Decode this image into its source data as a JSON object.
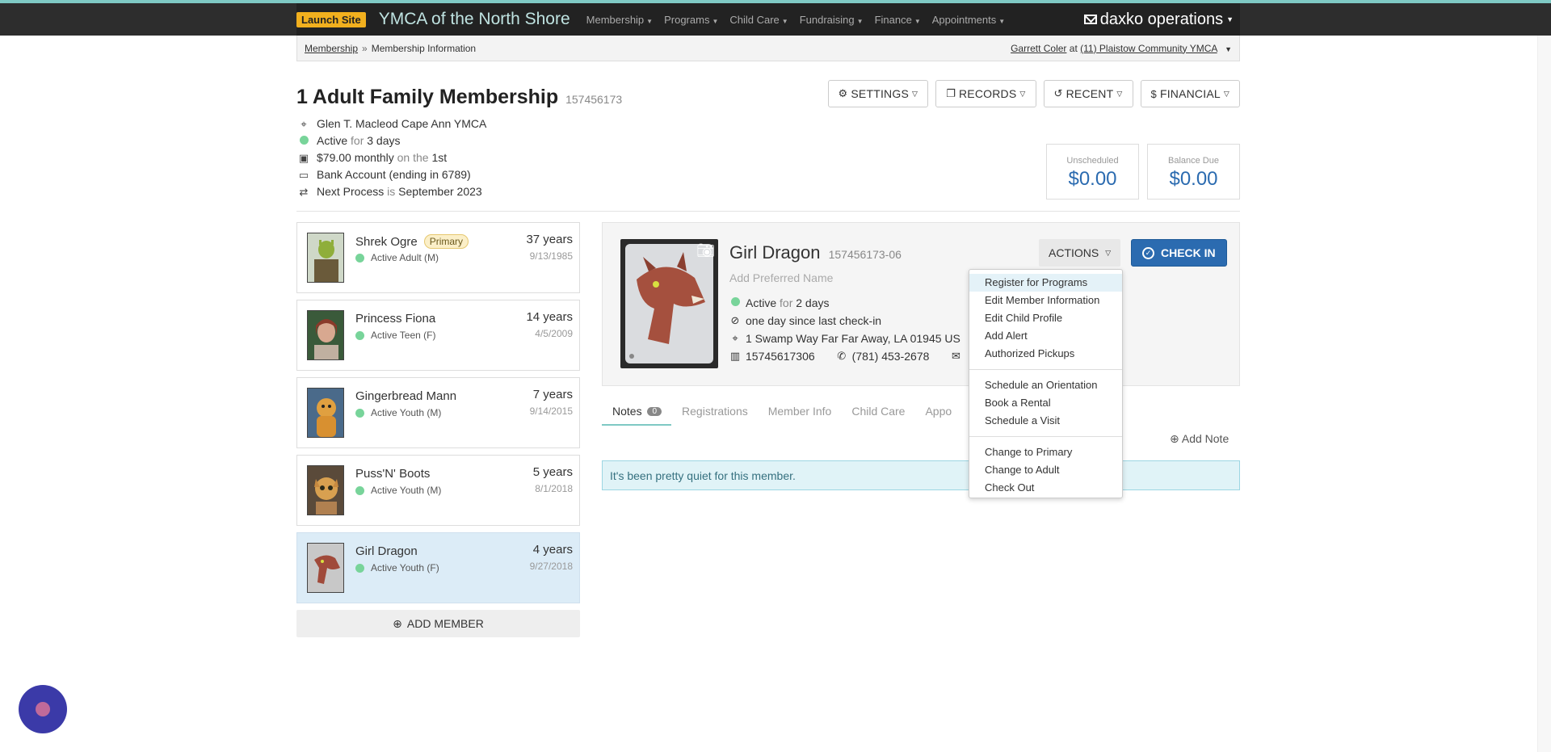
{
  "nav": {
    "launch_label": "Launch Site",
    "org_title": "YMCA of the North Shore",
    "items": [
      {
        "label": "Membership"
      },
      {
        "label": "Programs"
      },
      {
        "label": "Child Care"
      },
      {
        "label": "Fundraising"
      },
      {
        "label": "Finance"
      },
      {
        "label": "Appointments"
      }
    ],
    "brand": "daxko operations"
  },
  "breadcrumb": {
    "parent": "Membership",
    "separator": "»",
    "current": "Membership Information",
    "user": "Garrett Coler",
    "at": "at",
    "location": "(11) Plaistow Community YMCA"
  },
  "membership": {
    "title": "1 Adult Family Membership",
    "id": "157456173",
    "branch": "Glen T. Macleod Cape Ann YMCA",
    "status": "Active",
    "for_word": "for",
    "duration": "3 days",
    "price": "$79.00 monthly",
    "on_the": "on the",
    "day": "1st",
    "payment": "Bank Account (ending in 6789)",
    "next_label": "Next Process",
    "is_word": "is",
    "next_date": "September 2023"
  },
  "header_buttons": [
    {
      "label": "SETTINGS",
      "icon": "gear-icon"
    },
    {
      "label": "RECORDS",
      "icon": "copy-icon"
    },
    {
      "label": "RECENT",
      "icon": "history-icon"
    },
    {
      "label": "FINANCIAL",
      "icon": "dollar-icon"
    }
  ],
  "balances": {
    "unscheduled_label": "Unscheduled",
    "unscheduled_amount": "$0.00",
    "due_label": "Balance Due",
    "due_amount": "$0.00"
  },
  "members": [
    {
      "name": "Shrek Ogre",
      "badge": "Primary",
      "status": "Active Adult (M)",
      "age": "37 years",
      "dob": "9/13/1985"
    },
    {
      "name": "Princess Fiona",
      "badge": "",
      "status": "Active Teen (F)",
      "age": "14 years",
      "dob": "4/5/2009"
    },
    {
      "name": "Gingerbread Mann",
      "badge": "",
      "status": "Active Youth (M)",
      "age": "7 years",
      "dob": "9/14/2015"
    },
    {
      "name": "Puss'N' Boots",
      "badge": "",
      "status": "Active Youth (M)",
      "age": "5 years",
      "dob": "8/1/2018"
    },
    {
      "name": "Girl Dragon",
      "badge": "",
      "status": "Active Youth (F)",
      "age": "4 years",
      "dob": "9/27/2018"
    }
  ],
  "add_member_label": "ADD MEMBER",
  "selected_member": {
    "name": "Girl Dragon",
    "id": "157456173-06",
    "preferred_placeholder": "Add Preferred Name",
    "status": "Active",
    "for_word": "for",
    "duration": "2 days",
    "last_checkin": "one day since last check-in",
    "address": "1 Swamp Way Far Far Away, LA 01945 US",
    "barcode": "15745617306",
    "phone": "(781) 453-2678"
  },
  "actions_label": "ACTIONS",
  "checkin_label": "CHECK IN",
  "actions_menu": {
    "group1": [
      "Register for Programs",
      "Edit Member Information",
      "Edit Child Profile",
      "Add Alert",
      "Authorized Pickups"
    ],
    "group2": [
      "Schedule an Orientation",
      "Book a Rental",
      "Schedule a Visit"
    ],
    "group3": [
      "Change to Primary",
      "Change to Adult",
      "Check Out"
    ]
  },
  "tabs": [
    {
      "label": "Notes",
      "count": "0"
    },
    {
      "label": "Registrations"
    },
    {
      "label": "Member Info"
    },
    {
      "label": "Child Care"
    },
    {
      "label": "Appo"
    }
  ],
  "add_note_label": "Add Note",
  "notes_empty": "It's been pretty quiet for this member.",
  "colors": {
    "accent_teal": "#7fc9c4",
    "primary_blue": "#2b6bb0",
    "status_green": "#78d49a",
    "launch_yellow": "#f2b01e"
  }
}
